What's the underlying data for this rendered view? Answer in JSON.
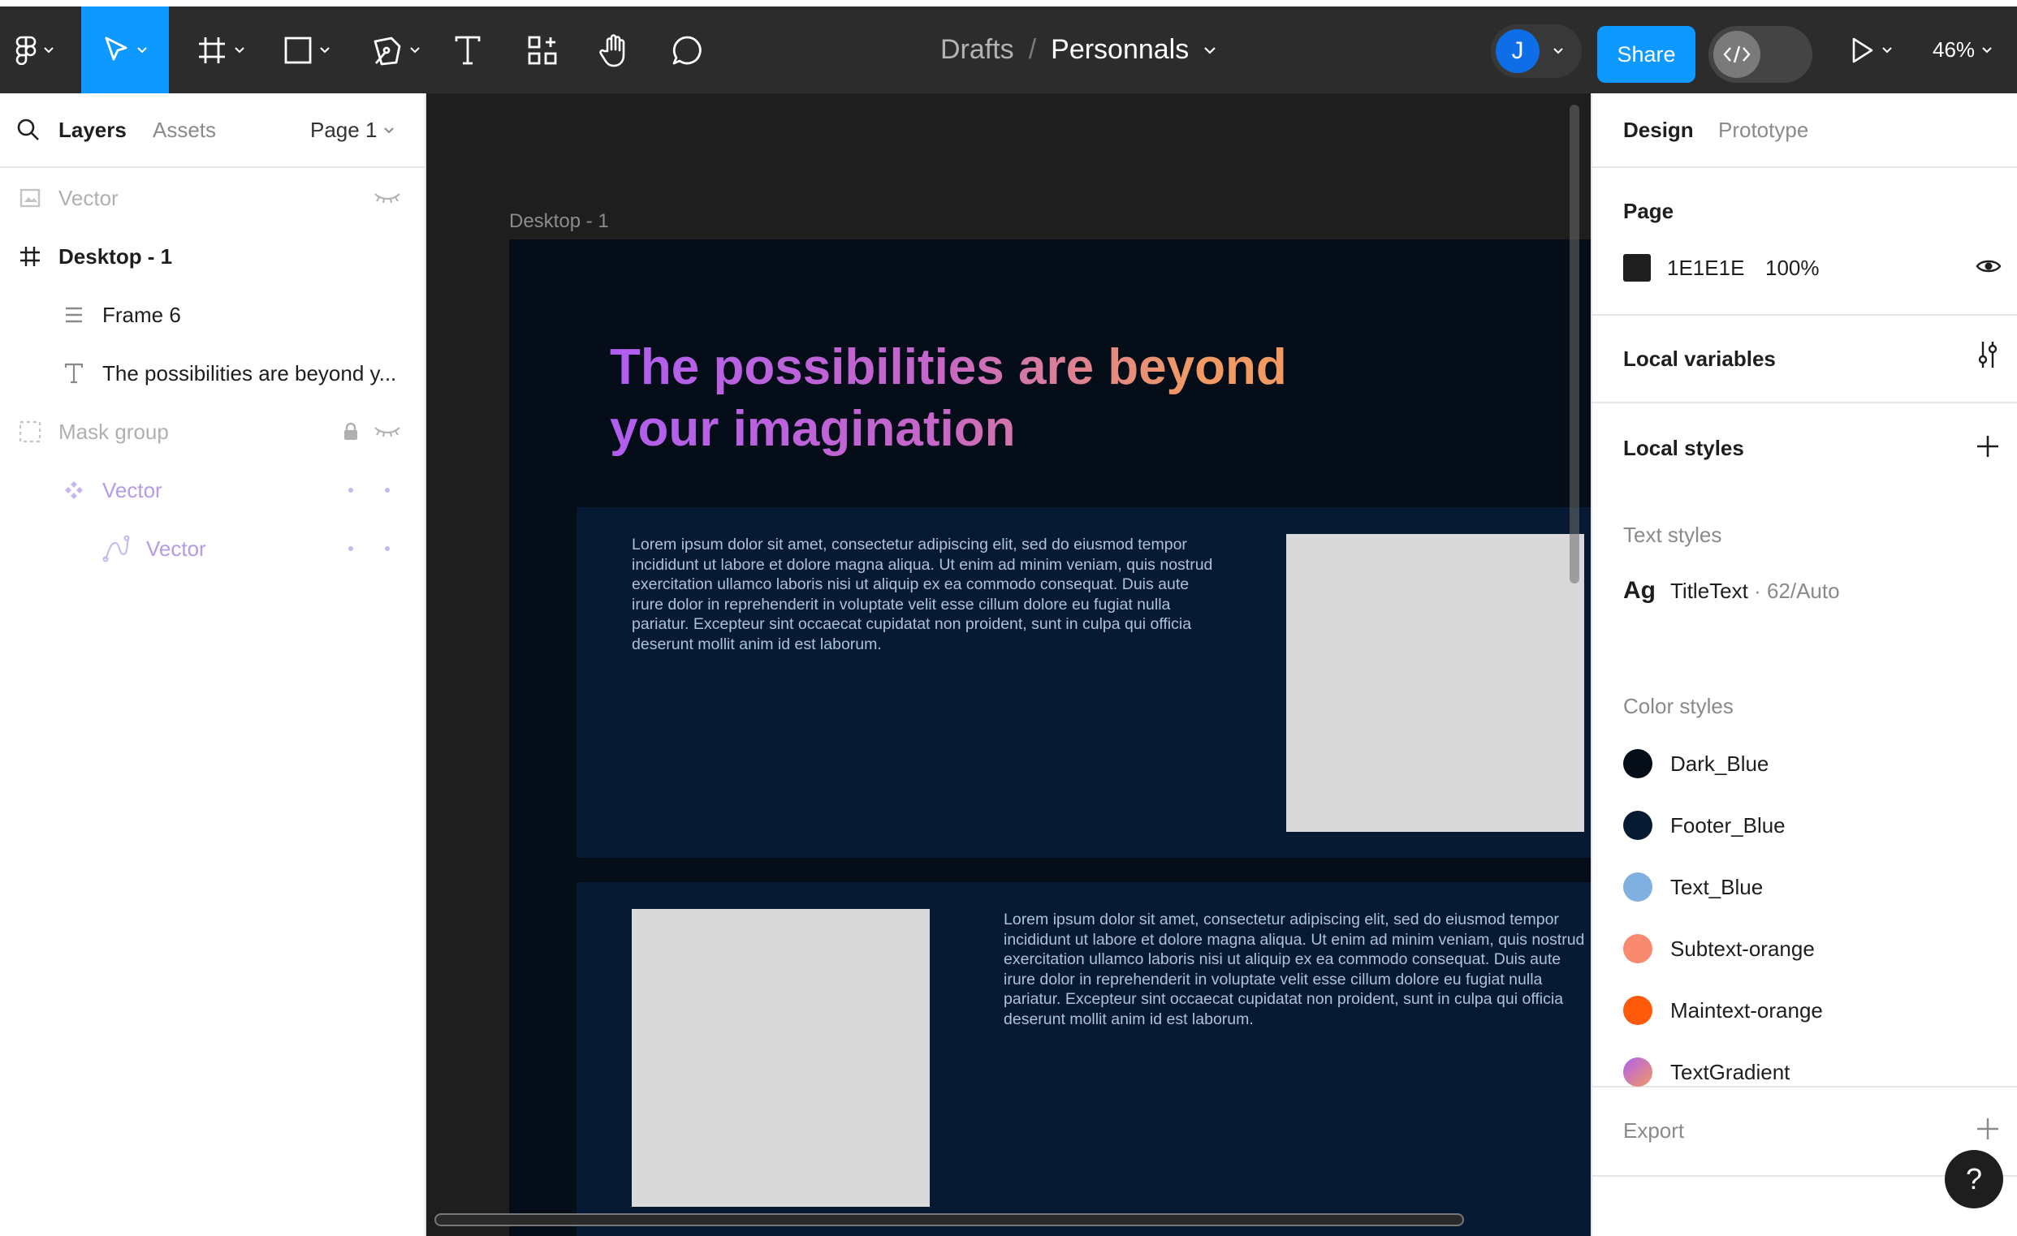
{
  "topbar": {
    "breadcrumb": {
      "parent": "Drafts",
      "separator": "/",
      "current": "Personnals"
    },
    "avatar_initial": "J",
    "share_label": "Share",
    "zoom": "46%"
  },
  "left_panel": {
    "tabs": {
      "layers": "Layers",
      "assets": "Assets"
    },
    "page_selector": "Page 1",
    "layers": [
      {
        "label": "Vector"
      },
      {
        "label": "Desktop - 1"
      },
      {
        "label": "Frame 6"
      },
      {
        "label": "The possibilities are beyond y..."
      },
      {
        "label": "Mask group"
      },
      {
        "label": "Vector"
      },
      {
        "label": "Vector"
      }
    ]
  },
  "canvas": {
    "frame_label": "Desktop - 1",
    "hero_title": "The possibilities are beyond your imagination",
    "lorem": "Lorem ipsum dolor sit amet, consectetur adipiscing elit, sed do eiusmod tempor incididunt ut labore et dolore magna aliqua. Ut enim ad minim veniam, quis nostrud exercitation ullamco laboris nisi ut aliquip ex ea commodo consequat. Duis aute irure dolor in reprehenderit in voluptate velit esse cillum dolore eu fugiat nulla pariatur. Excepteur sint occaecat cupidatat non proident, sunt in culpa qui officia deserunt mollit anim id est laborum."
  },
  "right_panel": {
    "tabs": {
      "design": "Design",
      "prototype": "Prototype"
    },
    "page": {
      "title": "Page",
      "color_hex": "1E1E1E",
      "opacity": "100%"
    },
    "local_variables": "Local variables",
    "local_styles": "Local styles",
    "text_styles": {
      "title": "Text styles",
      "items": [
        {
          "sample": "Ag",
          "name": "TitleText",
          "meta": " · 62/Auto"
        }
      ]
    },
    "color_styles": {
      "title": "Color styles",
      "items": [
        {
          "name": "Dark_Blue",
          "color": "#050d18"
        },
        {
          "name": "Footer_Blue",
          "color": "#071a33"
        },
        {
          "name": "Text_Blue",
          "color": "#7fb0e0"
        },
        {
          "name": "Subtext-orange",
          "color": "#f98a70"
        },
        {
          "name": "Maintext-orange",
          "color": "#ff5a0a"
        },
        {
          "name": "TextGradient",
          "color": "linear-gradient(135deg,#b05ef0,#f29a62)"
        }
      ]
    },
    "export": "Export",
    "help": "?"
  }
}
